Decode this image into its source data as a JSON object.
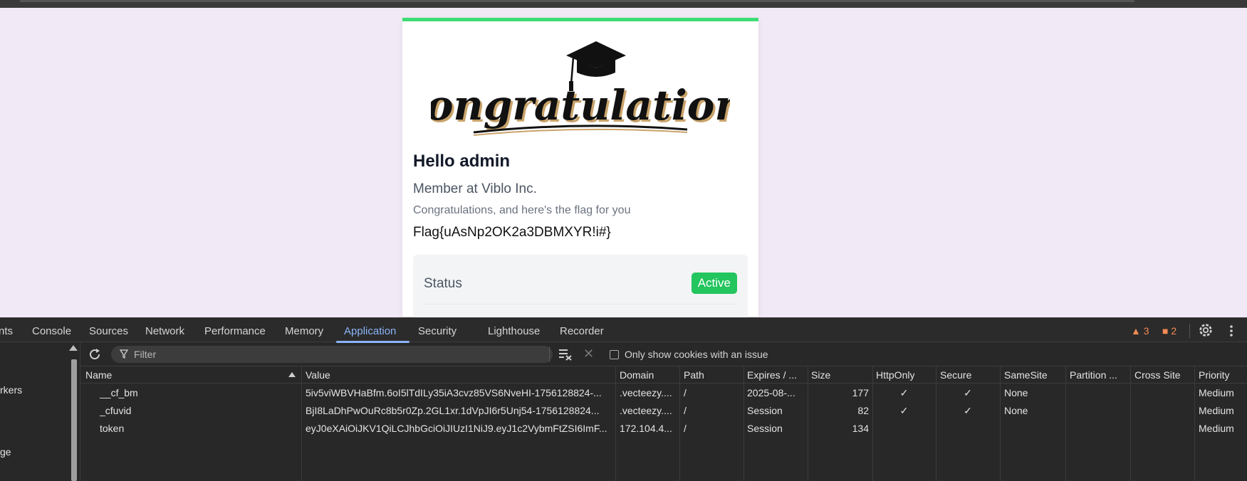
{
  "page": {
    "hello": "Hello admin",
    "member": "Member at Viblo Inc.",
    "congrats": "Congratulations, and here's the flag for you",
    "flag": "Flag{uAsNp2OK2a3DBMXYR!i#}",
    "status_label": "Status",
    "status_value": "Active",
    "logo_text": "Congratulations",
    "colors": {
      "accent": "#3ddc74",
      "badge": "#22c55e",
      "page_bg": "#f2e9f6"
    }
  },
  "devtools": {
    "tabs": [
      "nts",
      "Console",
      "Sources",
      "Network",
      "Performance",
      "Memory",
      "Application",
      "Security",
      "Lighthouse",
      "Recorder"
    ],
    "active_tab": "Application",
    "warnings": "3",
    "errors": "2",
    "sidebar_items": [
      "rkers",
      "ge"
    ],
    "filter_placeholder": "Filter",
    "only_issue_label": "Only show cookies with an issue",
    "columns": [
      "Name",
      "Value",
      "Domain",
      "Path",
      "Expires / ...",
      "Size",
      "HttpOnly",
      "Secure",
      "SameSite",
      "Partition ...",
      "Cross Site",
      "Priority"
    ],
    "rows": [
      {
        "name": "__cf_bm",
        "value": "5iv5viWBVHaBfm.6oI5lTdILy35iA3cvz85VS6NveHI-1756128824-...",
        "domain": ".vecteezy....",
        "path": "/",
        "expires": "2025-08-...",
        "size": "177",
        "httponly": "✓",
        "secure": "✓",
        "samesite": "None",
        "partition": "",
        "crosssite": "",
        "priority": "Medium"
      },
      {
        "name": "_cfuvid",
        "value": "BjI8LaDhPwOuRc8b5r0Zp.2GL1xr.1dVpJI6r5Unj54-1756128824...",
        "domain": ".vecteezy....",
        "path": "/",
        "expires": "Session",
        "size": "82",
        "httponly": "✓",
        "secure": "✓",
        "samesite": "None",
        "partition": "",
        "crosssite": "",
        "priority": "Medium"
      },
      {
        "name": "token",
        "value": "eyJ0eXAiOiJKV1QiLCJhbGciOiJIUzI1NiJ9.eyJ1c2VybmFtZSI6ImF...",
        "domain": "172.104.4...",
        "path": "/",
        "expires": "Session",
        "size": "134",
        "httponly": "",
        "secure": "",
        "samesite": "",
        "partition": "",
        "crosssite": "",
        "priority": "Medium"
      }
    ]
  }
}
